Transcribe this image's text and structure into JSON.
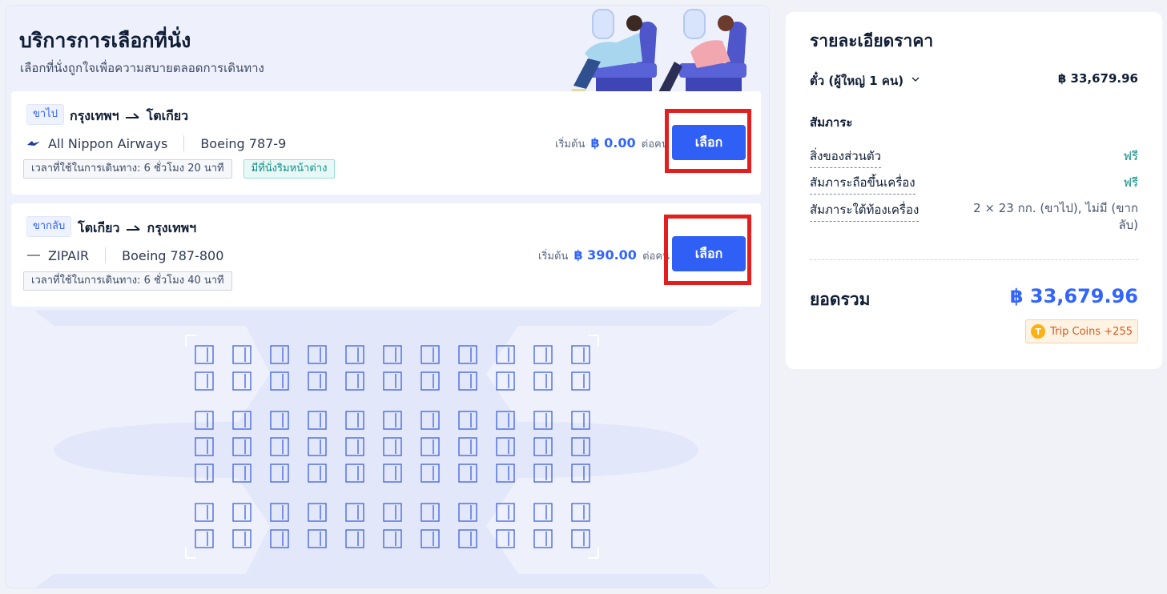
{
  "seat_service": {
    "title": "บริการการเลือกที่นั่ง",
    "subtitle": "เลือกที่นั่งถูกใจเพื่อความสบายตลอดการเดินทาง"
  },
  "flights": [
    {
      "tag": "ขาไป",
      "from": "กรุงเทพฯ",
      "to": "โตเกียว",
      "airline": "All Nippon Airways",
      "aircraft": "Boeing 787-9",
      "duration": "เวลาที่ใช้ในการเดินทาง: 6 ชั่วโมง 20 นาที",
      "feature": "มีที่นั่งริมหน้าต่าง",
      "price_prefix": "เริ่มต้น",
      "price": "฿ 0.00",
      "price_suffix": "ต่อคน",
      "button": "เลือก"
    },
    {
      "tag": "ขากลับ",
      "from": "โตเกียว",
      "to": "กรุงเทพฯ",
      "airline": "ZIPAIR",
      "aircraft": "Boeing 787-800",
      "duration": "เวลาที่ใช้ในการเดินทาง: 6 ชั่วโมง 40 นาที",
      "price_prefix": "เริ่มต้น",
      "price": "฿ 390.00",
      "price_suffix": "ต่อคน",
      "button": "เลือก"
    }
  ],
  "price_details": {
    "title": "รายละเอียดราคา",
    "ticket_label": "ตั๋ว (ผู้ใหญ่ 1 คน)",
    "ticket_price": "฿ 33,679.96",
    "baggage_heading": "สัมภาระ",
    "baggage": [
      {
        "label": "สิ่งของส่วนตัว",
        "value": "ฟรี"
      },
      {
        "label": "สัมภาระถือขึ้นเครื่อง",
        "value": "ฟรี"
      },
      {
        "label": "สัมภาระใต้ท้องเครื่อง",
        "value": "2 × 23 กก. (ขาไป), ไม่มี (ขากลับ)"
      }
    ],
    "total_label": "ยอดรวม",
    "total_value": "฿ 33,679.96",
    "coins_label": "Trip Coins +255"
  },
  "colors": {
    "accent": "#2f5ff5",
    "price_blue": "#3264ff",
    "free_green": "#0e8f84",
    "highlight_red": "#e21e1e"
  }
}
